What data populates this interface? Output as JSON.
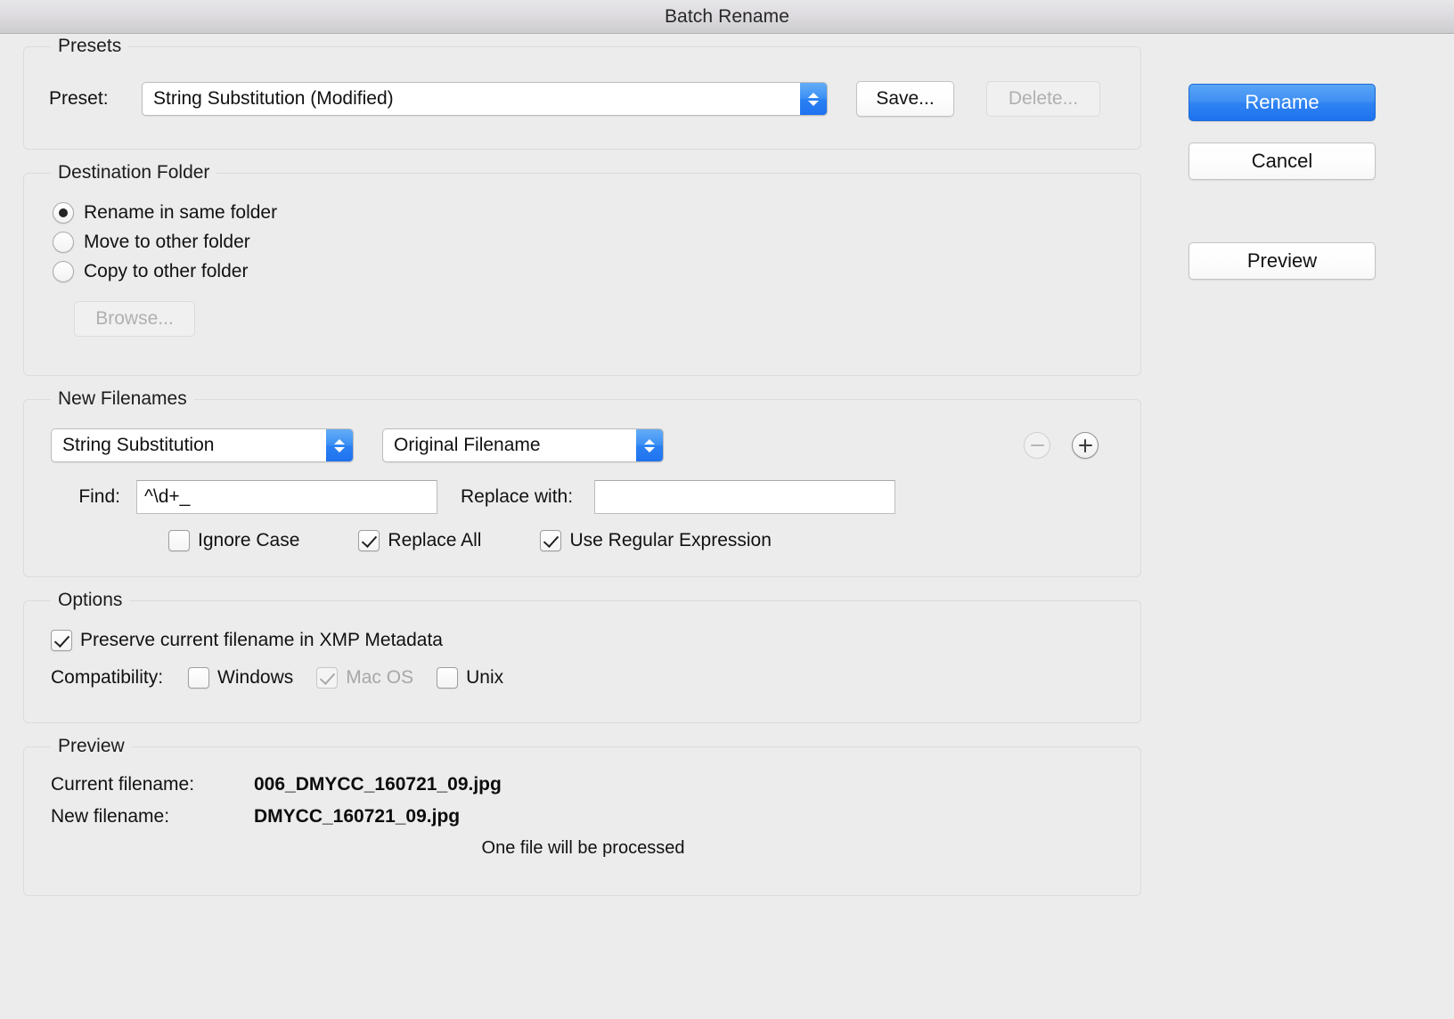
{
  "window": {
    "title": "Batch Rename"
  },
  "presets": {
    "legend": "Presets",
    "preset_label": "Preset:",
    "preset_value": "String Substitution (Modified)",
    "save_label": "Save...",
    "delete_label": "Delete..."
  },
  "destination": {
    "legend": "Destination Folder",
    "options": [
      {
        "label": "Rename in same folder",
        "checked": true
      },
      {
        "label": "Move to other folder",
        "checked": false
      },
      {
        "label": "Copy to other folder",
        "checked": false
      }
    ],
    "browse_label": "Browse..."
  },
  "new_filenames": {
    "legend": "New Filenames",
    "method_value": "String Substitution",
    "source_value": "Original Filename",
    "remove_icon": "minus-circle-icon",
    "add_icon": "plus-circle-icon",
    "find_label": "Find:",
    "find_value": "^\\d+_",
    "replace_label": "Replace with:",
    "replace_value": "",
    "checkboxes": [
      {
        "label": "Ignore Case",
        "checked": false
      },
      {
        "label": "Replace All",
        "checked": true
      },
      {
        "label": "Use Regular Expression",
        "checked": true
      }
    ]
  },
  "options": {
    "legend": "Options",
    "preserve_label": "Preserve current filename in XMP Metadata",
    "preserve_checked": true,
    "compatibility_label": "Compatibility:",
    "compatibility": [
      {
        "label": "Windows",
        "checked": false,
        "disabled": false
      },
      {
        "label": "Mac OS",
        "checked": true,
        "disabled": true
      },
      {
        "label": "Unix",
        "checked": false,
        "disabled": false
      }
    ]
  },
  "preview": {
    "legend": "Preview",
    "current_label": "Current filename:",
    "current_value": "006_DMYCC_160721_09.jpg",
    "new_label": "New filename:",
    "new_value": "DMYCC_160721_09.jpg",
    "status": "One file will be processed"
  },
  "actions": {
    "rename_label": "Rename",
    "cancel_label": "Cancel",
    "preview_label": "Preview"
  },
  "colors": {
    "accent": "#2f83f2",
    "window_bg": "#ececec",
    "group_border": "#dcdcdc"
  }
}
